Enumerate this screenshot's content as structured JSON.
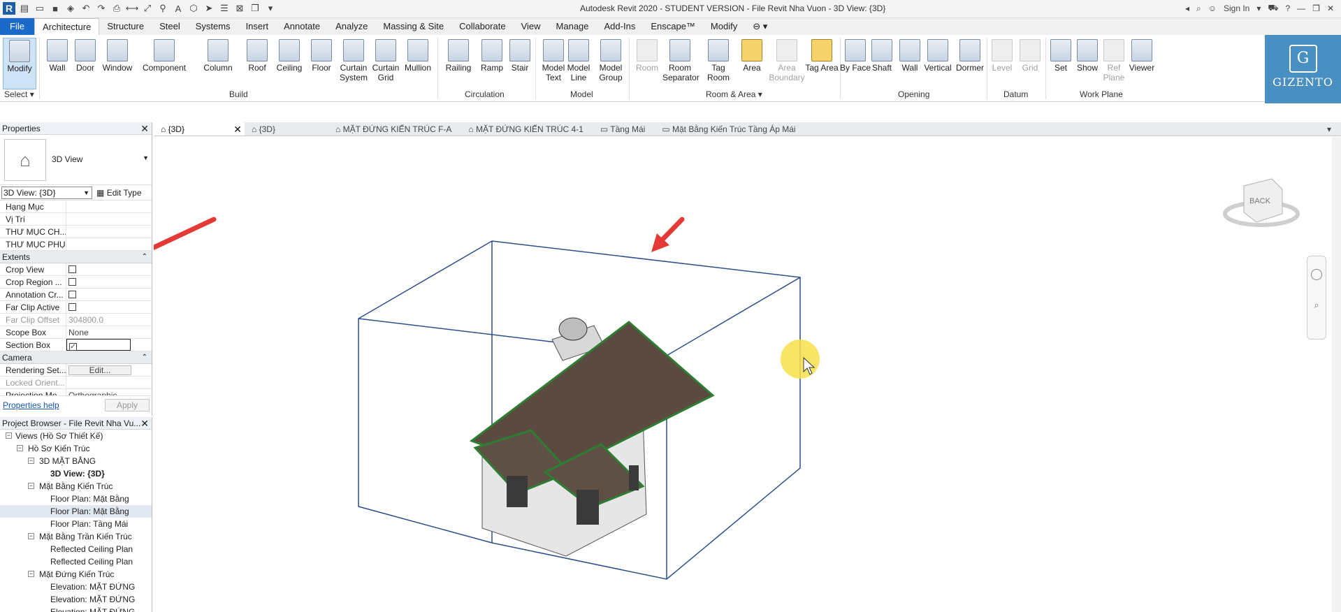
{
  "window": {
    "title": "Autodesk Revit 2020 - STUDENT VERSION - File Revit Nha Vuon - 3D View: {3D}",
    "sign_in": "Sign In"
  },
  "ribbon_tabs": [
    "File",
    "Architecture",
    "Structure",
    "Steel",
    "Systems",
    "Insert",
    "Annotate",
    "Analyze",
    "Massing & Site",
    "Collaborate",
    "View",
    "Manage",
    "Add-Ins",
    "Enscape™",
    "Modify"
  ],
  "ribbon": {
    "select_label": "Select",
    "panels": {
      "build": "Build",
      "circulation": "Circulation",
      "model": "Model",
      "room_area": "Room & Area",
      "opening": "Opening",
      "datum": "Datum",
      "work_plane": "Work Plane"
    },
    "tools": {
      "modify": "Modify",
      "wall": "Wall",
      "door": "Door",
      "window": "Window",
      "component": "Component",
      "column": "Column",
      "roof": "Roof",
      "ceiling": "Ceiling",
      "floor": "Floor",
      "curtain_system": "Curtain System",
      "curtain_grid": "Curtain Grid",
      "mullion": "Mullion",
      "railing": "Railing",
      "ramp": "Ramp",
      "stair": "Stair",
      "model_text": "Model Text",
      "model_line": "Model Line",
      "model_group": "Model Group",
      "room": "Room",
      "room_separator": "Room Separator",
      "tag_room": "Tag Room",
      "area": "Area",
      "area_boundary": "Area Boundary",
      "tag_area": "Tag Area",
      "by_face": "By Face",
      "shaft": "Shaft",
      "wall_opening": "Wall",
      "vertical": "Vertical",
      "dormer": "Dormer",
      "level": "Level",
      "grid": "Grid",
      "set": "Set",
      "show": "Show",
      "ref_plane": "Ref Plane",
      "viewer": "Viewer"
    }
  },
  "brand": {
    "letter": "G",
    "name": "GIZENTO"
  },
  "properties": {
    "header": "Properties",
    "type_name": "3D View",
    "view_selector": "3D View: {3D}",
    "edit_type": "Edit Type",
    "rows_top": [
      {
        "k": "Hạng Mục",
        "v": ""
      },
      {
        "k": "Vị Trí",
        "v": ""
      },
      {
        "k": "THƯ MỤC CH...",
        "v": ""
      },
      {
        "k": "THƯ MỤC PHỤ",
        "v": ""
      }
    ],
    "group_extents": "Extents",
    "extents": [
      {
        "k": "Crop View",
        "cb": ""
      },
      {
        "k": "Crop Region ...",
        "cb": ""
      },
      {
        "k": "Annotation Cr...",
        "cb": ""
      },
      {
        "k": "Far Clip Active",
        "cb": ""
      }
    ],
    "far_clip_offset": {
      "k": "Far Clip Offset",
      "v": "304800.0"
    },
    "scope_box": {
      "k": "Scope Box",
      "v": "None"
    },
    "section_box": {
      "k": "Section Box",
      "cb": "✓"
    },
    "group_camera": "Camera",
    "rendering_settings": {
      "k": "Rendering Set...",
      "v": "Edit..."
    },
    "locked_orient": {
      "k": "Locked Orient...",
      "v": ""
    },
    "projection_mode": {
      "k": "Projection Mo...",
      "v": "Orthographic"
    },
    "help": "Properties help",
    "apply": "Apply"
  },
  "browser": {
    "header": "Project Browser - File Revit Nha Vu...",
    "nodes": [
      {
        "label": "Views (Hồ Sơ Thiết Kế)",
        "toggle": "−"
      },
      {
        "label": "Hồ Sơ Kiến Trúc",
        "toggle": "−"
      },
      {
        "label": "3D MẶT BẰNG",
        "toggle": "−"
      },
      {
        "label": "3D View: {3D}",
        "toggle": ""
      },
      {
        "label": "Mặt Bằng Kiến Trúc",
        "toggle": "−"
      },
      {
        "label": "Floor Plan: Mặt Bằng",
        "toggle": ""
      },
      {
        "label": "Floor Plan: Mặt Bằng",
        "toggle": ""
      },
      {
        "label": "Floor Plan: Tầng Mái",
        "toggle": ""
      },
      {
        "label": "Mặt Bằng Trần Kiến Trúc",
        "toggle": "−"
      },
      {
        "label": "Reflected Ceiling Plan",
        "toggle": ""
      },
      {
        "label": "Reflected Ceiling Plan",
        "toggle": ""
      },
      {
        "label": "Mặt Đứng Kiến Trúc",
        "toggle": "−"
      },
      {
        "label": "Elevation: MẶT ĐỨNG",
        "toggle": ""
      },
      {
        "label": "Elevation: MẶT ĐỨNG",
        "toggle": ""
      },
      {
        "label": "Elevation: MẶT ĐỨNG",
        "toggle": ""
      }
    ]
  },
  "view_tabs": [
    "{3D}",
    "{3D}",
    "MẶT ĐỨNG KIẾN TRÚC F-A",
    "MẶT ĐỨNG KIẾN TRÚC 4-1",
    "Tầng Mái",
    "Mặt Bằng Kiến Trúc Tầng Áp Mái"
  ],
  "viewcube": {
    "face": "BACK"
  },
  "colors": {
    "file_tab": "#1b6ac9",
    "section_box": "#2b4f8a",
    "roof_edge": "#2e7d32",
    "annotation_arrow": "#e53935",
    "cursor_highlight": "#f7e04a"
  }
}
